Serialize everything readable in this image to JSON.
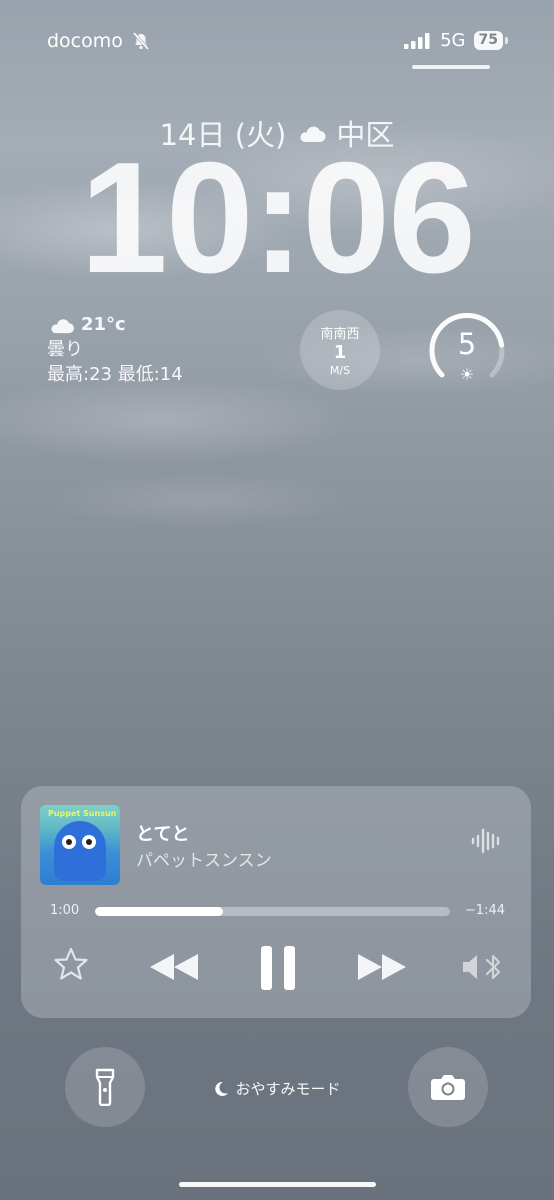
{
  "status_bar": {
    "carrier": "docomo",
    "network": "5G",
    "battery": "75",
    "icons": [
      "silent-bell-icon",
      "signal-bars-icon",
      "battery-icon"
    ]
  },
  "lockscreen": {
    "date": "14日 (火)",
    "location": "中区",
    "time": "10:06",
    "weather": {
      "temp": "21°c",
      "condition": "曇り",
      "high_low": "最高:23 最低:14",
      "icon": "cloud-icon"
    },
    "wind": {
      "direction": "南南西",
      "speed": "1",
      "unit": "M/S"
    },
    "uv": {
      "value": "5",
      "icon": "sun-icon",
      "level_fraction": 0.8
    }
  },
  "now_playing": {
    "album_art_text": "Puppet Sunsun",
    "title": "とてと",
    "artist": "パペットスンスン",
    "elapsed": "1:00",
    "remaining": "−1:44",
    "progress": 0.36,
    "controls": [
      "favorite-star",
      "rewind",
      "pause",
      "fast-forward",
      "audio-output"
    ]
  },
  "bottom": {
    "focus_mode": "おやすみモード",
    "left_button": "flashlight-icon",
    "right_button": "camera-icon"
  }
}
